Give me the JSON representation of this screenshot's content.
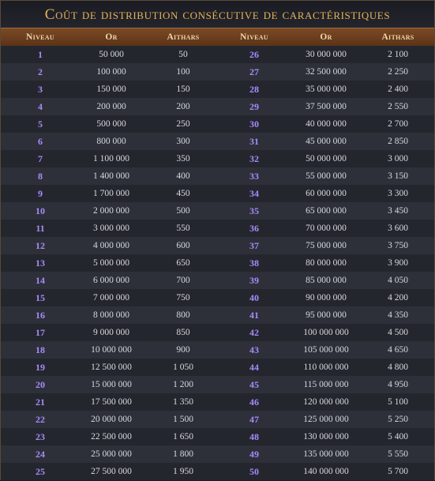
{
  "title": "Coût de distribution consécutive de caractéristiques",
  "headers": [
    "Niveau",
    "Or",
    "Aithars",
    "Niveau",
    "Or",
    "Aithars"
  ],
  "rows": [
    {
      "l1": "1",
      "o1": "50 000",
      "a1": "50",
      "l2": "26",
      "o2": "30 000 000",
      "a2": "2 100"
    },
    {
      "l1": "2",
      "o1": "100 000",
      "a1": "100",
      "l2": "27",
      "o2": "32 500 000",
      "a2": "2 250"
    },
    {
      "l1": "3",
      "o1": "150 000",
      "a1": "150",
      "l2": "28",
      "o2": "35 000 000",
      "a2": "2 400"
    },
    {
      "l1": "4",
      "o1": "200 000",
      "a1": "200",
      "l2": "29",
      "o2": "37 500 000",
      "a2": "2 550"
    },
    {
      "l1": "5",
      "o1": "500 000",
      "a1": "250",
      "l2": "30",
      "o2": "40 000 000",
      "a2": "2 700"
    },
    {
      "l1": "6",
      "o1": "800 000",
      "a1": "300",
      "l2": "31",
      "o2": "45 000 000",
      "a2": "2 850"
    },
    {
      "l1": "7",
      "o1": "1 100 000",
      "a1": "350",
      "l2": "32",
      "o2": "50 000 000",
      "a2": "3 000"
    },
    {
      "l1": "8",
      "o1": "1 400 000",
      "a1": "400",
      "l2": "33",
      "o2": "55 000 000",
      "a2": "3 150"
    },
    {
      "l1": "9",
      "o1": "1 700 000",
      "a1": "450",
      "l2": "34",
      "o2": "60 000 000",
      "a2": "3 300"
    },
    {
      "l1": "10",
      "o1": "2 000 000",
      "a1": "500",
      "l2": "35",
      "o2": "65 000 000",
      "a2": "3 450"
    },
    {
      "l1": "11",
      "o1": "3 000 000",
      "a1": "550",
      "l2": "36",
      "o2": "70 000 000",
      "a2": "3 600"
    },
    {
      "l1": "12",
      "o1": "4 000 000",
      "a1": "600",
      "l2": "37",
      "o2": "75 000 000",
      "a2": "3 750"
    },
    {
      "l1": "13",
      "o1": "5 000 000",
      "a1": "650",
      "l2": "38",
      "o2": "80 000 000",
      "a2": "3 900"
    },
    {
      "l1": "14",
      "o1": "6 000 000",
      "a1": "700",
      "l2": "39",
      "o2": "85 000 000",
      "a2": "4 050"
    },
    {
      "l1": "15",
      "o1": "7 000 000",
      "a1": "750",
      "l2": "40",
      "o2": "90 000 000",
      "a2": "4 200"
    },
    {
      "l1": "16",
      "o1": "8 000 000",
      "a1": "800",
      "l2": "41",
      "o2": "95 000 000",
      "a2": "4 350"
    },
    {
      "l1": "17",
      "o1": "9 000 000",
      "a1": "850",
      "l2": "42",
      "o2": "100 000 000",
      "a2": "4 500"
    },
    {
      "l1": "18",
      "o1": "10 000 000",
      "a1": "900",
      "l2": "43",
      "o2": "105 000 000",
      "a2": "4 650"
    },
    {
      "l1": "19",
      "o1": "12 500 000",
      "a1": "1 050",
      "l2": "44",
      "o2": "110 000 000",
      "a2": "4 800"
    },
    {
      "l1": "20",
      "o1": "15 000 000",
      "a1": "1 200",
      "l2": "45",
      "o2": "115 000 000",
      "a2": "4 950"
    },
    {
      "l1": "21",
      "o1": "17 500 000",
      "a1": "1 350",
      "l2": "46",
      "o2": "120 000 000",
      "a2": "5 100"
    },
    {
      "l1": "22",
      "o1": "20 000 000",
      "a1": "1 500",
      "l2": "47",
      "o2": "125 000 000",
      "a2": "5 250"
    },
    {
      "l1": "23",
      "o1": "22 500 000",
      "a1": "1 650",
      "l2": "48",
      "o2": "130 000 000",
      "a2": "5 400"
    },
    {
      "l1": "24",
      "o1": "25 000 000",
      "a1": "1 800",
      "l2": "49",
      "o2": "135 000 000",
      "a2": "5 550"
    },
    {
      "l1": "25",
      "o1": "27 500 000",
      "a1": "1 950",
      "l2": "50",
      "o2": "140 000 000",
      "a2": "5 700"
    }
  ],
  "colors": {
    "title": "#e6b35a",
    "header_bg": "#6b3f1e",
    "level": "#a78bfa",
    "row_alt": "#2d3039",
    "row_base": "#24262e"
  }
}
